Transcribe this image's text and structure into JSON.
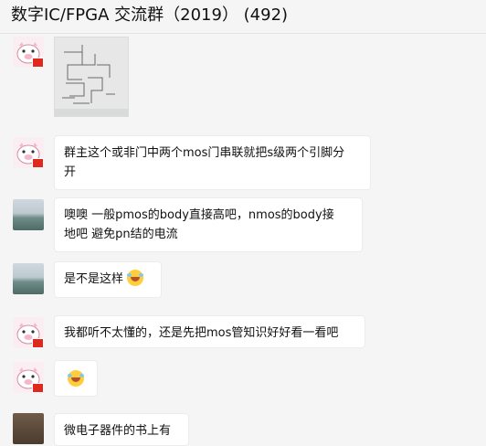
{
  "window": {
    "title": "数字IC/FPGA 交流群（2019） (492)"
  },
  "messages": [
    {
      "kind": "image",
      "avatar": "pig-avatar",
      "image_desc": "circuit-sketch-photo"
    },
    {
      "kind": "text",
      "avatar": "pig-avatar",
      "lines": [
        "群主这个或非门中两个mos门串联就把s级两个引脚分",
        "开"
      ]
    },
    {
      "kind": "text",
      "avatar": "lake-avatar",
      "lines": [
        "噢噢  一般pmos的body直接高吧，nmos的body接",
        "地吧 避免pn结的电流"
      ]
    },
    {
      "kind": "text",
      "avatar": "lake-avatar",
      "text": "是不是这样",
      "emoji": "laugh-cry-emoji"
    },
    {
      "kind": "text",
      "avatar": "pig-avatar",
      "text": "我都听不太懂的，还是先把mos管知识好好看一看吧"
    },
    {
      "kind": "emoji",
      "avatar": "pig-avatar",
      "emoji": "laugh-cry-emoji"
    },
    {
      "kind": "text",
      "avatar": "dark-avatar",
      "text": "微电子器件的书上有"
    }
  ],
  "colors": {
    "background": "#f5f5f5",
    "bubble": "#ffffff",
    "flag_badge": "#e0291d"
  }
}
